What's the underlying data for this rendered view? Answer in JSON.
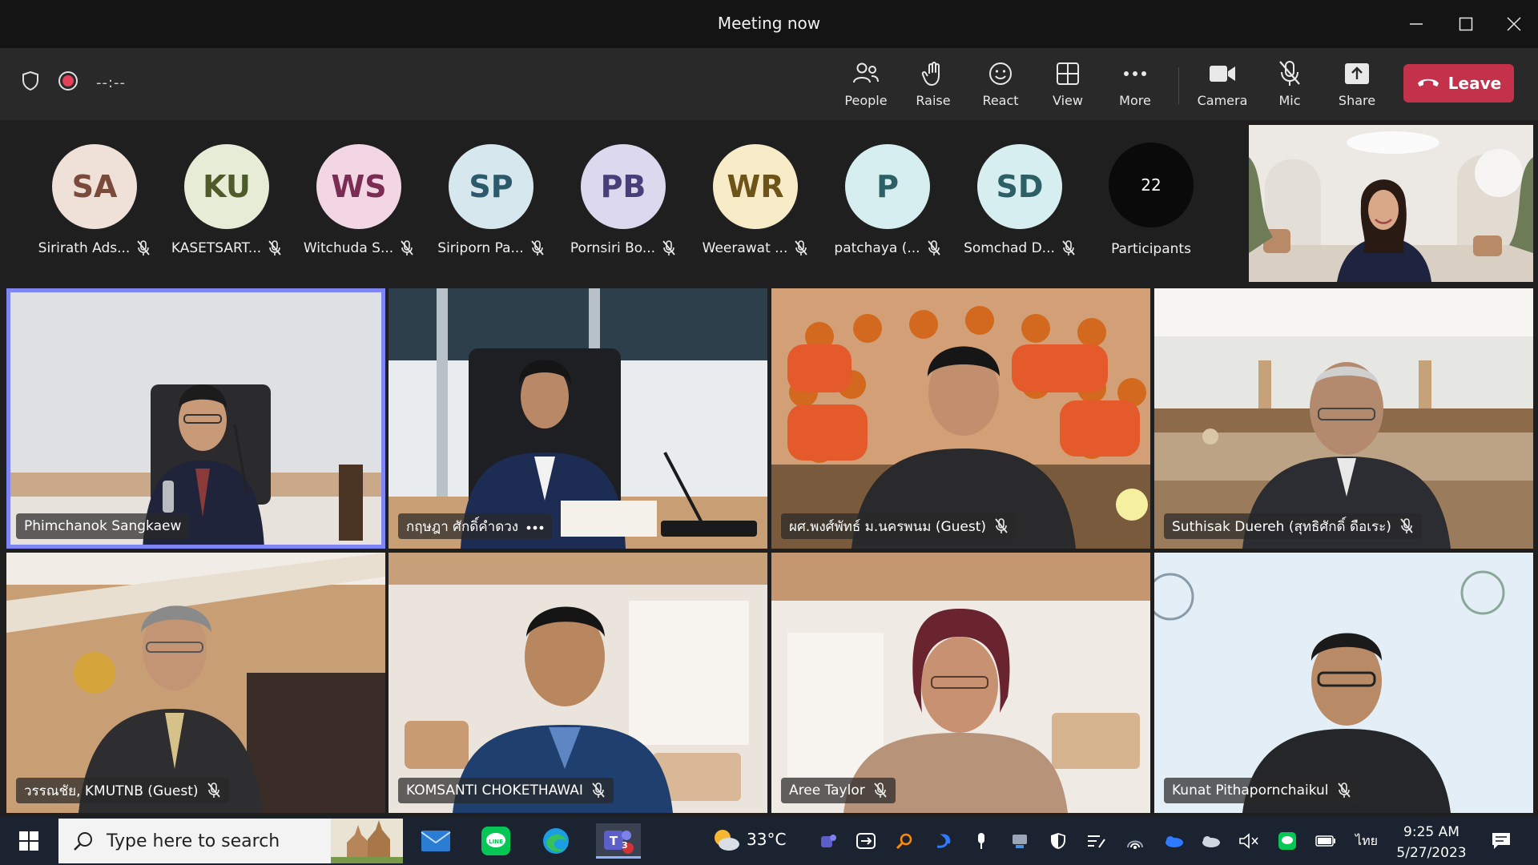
{
  "window": {
    "title": "Meeting now"
  },
  "toolbar": {
    "timer": "--:--",
    "buttons": [
      {
        "label": "People",
        "icon": "people-icon"
      },
      {
        "label": "Raise",
        "icon": "hand-icon"
      },
      {
        "label": "React",
        "icon": "smiley-icon"
      },
      {
        "label": "View",
        "icon": "grid-icon"
      },
      {
        "label": "More",
        "icon": "ellipsis-icon"
      },
      {
        "label": "Camera",
        "icon": "camera-icon"
      },
      {
        "label": "Mic",
        "icon": "mic-muted-icon"
      },
      {
        "label": "Share",
        "icon": "share-icon"
      }
    ],
    "leave_label": "Leave"
  },
  "strip": {
    "people": [
      {
        "initials": "SA",
        "name": "Sirirath Ads...",
        "bg": "#efe0d8",
        "fg": "#7a4a3a"
      },
      {
        "initials": "KU",
        "name": "KASETSART...",
        "bg": "#e6ecd6",
        "fg": "#4d5a2a"
      },
      {
        "initials": "WS",
        "name": "Witchuda S...",
        "bg": "#f2d6e4",
        "fg": "#7a2c52"
      },
      {
        "initials": "SP",
        "name": "Siriporn Pa...",
        "bg": "#d6e8ee",
        "fg": "#2d5a6a"
      },
      {
        "initials": "PB",
        "name": "Pornsiri Bo...",
        "bg": "#dcd8ee",
        "fg": "#473f7a"
      },
      {
        "initials": "WR",
        "name": "Weerawat ...",
        "bg": "#f8ecc8",
        "fg": "#6e5418"
      },
      {
        "initials": "P",
        "name": "patchaya (...",
        "bg": "#d6eef0",
        "fg": "#2d6066"
      },
      {
        "initials": "SD",
        "name": "Somchad D...",
        "bg": "#d6eef0",
        "fg": "#2d6066"
      }
    ],
    "participants_count": "22",
    "participants_label": "Participants"
  },
  "grid": {
    "tiles": [
      {
        "name": "Phimchanok Sangkaew",
        "muted": false,
        "more": false
      },
      {
        "name": "กฤษฎา ศักดิ์คำดวง",
        "muted": false,
        "more": true
      },
      {
        "name": "ผศ.พงศ์พัทธ์ ม.นครพนม (Guest)",
        "muted": true,
        "more": false
      },
      {
        "name": "Suthisak Duereh (สุทธิศักดิ์ ดือเระ)",
        "muted": true,
        "more": false
      },
      {
        "name": "วรรณชัย, KMUTNB (Guest)",
        "muted": true,
        "more": false
      },
      {
        "name": "KOMSANTI CHOKETHAWAI",
        "muted": true,
        "more": false
      },
      {
        "name": "Aree Taylor",
        "muted": true,
        "more": false
      },
      {
        "name": "Kunat Pithapornchaikul",
        "muted": true,
        "more": false
      }
    ]
  },
  "taskbar": {
    "search_placeholder": "Type here to search",
    "weather_temp": "33°C",
    "teams_badge": "3",
    "language": "ไทย",
    "time": "9:25 AM",
    "date": "5/27/2023"
  }
}
